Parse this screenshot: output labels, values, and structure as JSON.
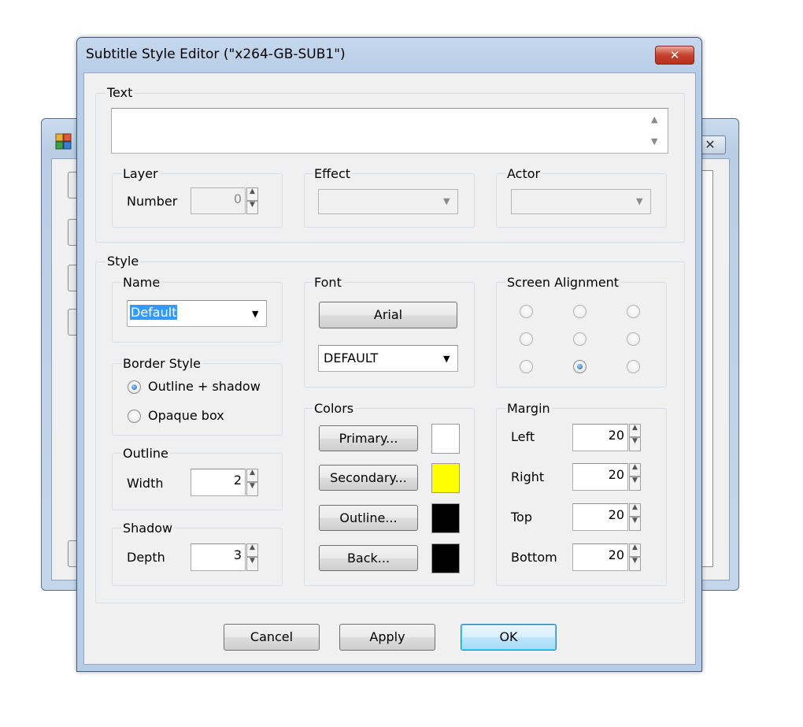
{
  "dialog": {
    "title": "Subtitle Style Editor (\"x264-GB-SUB1\")",
    "close_glyph": "✕"
  },
  "text_group": {
    "label": "Text",
    "value": ""
  },
  "layer": {
    "label": "Layer",
    "number_label": "Number",
    "number_value": "0"
  },
  "effect": {
    "label": "Effect",
    "value": ""
  },
  "actor": {
    "label": "Actor",
    "value": ""
  },
  "style": {
    "label": "Style",
    "name_label": "Name",
    "name_value": "Default",
    "border_style": {
      "label": "Border Style",
      "options": [
        "Outline + shadow",
        "Opaque box"
      ],
      "selected": "Outline + shadow"
    },
    "outline": {
      "label": "Outline",
      "width_label": "Width",
      "width_value": "2"
    },
    "shadow": {
      "label": "Shadow",
      "depth_label": "Depth",
      "depth_value": "3"
    },
    "font": {
      "label": "Font",
      "button_label": "Arial",
      "encoding_value": "DEFAULT"
    },
    "colors": {
      "label": "Colors",
      "primary_label": "Primary...",
      "secondary_label": "Secondary...",
      "outline_label": "Outline...",
      "back_label": "Back...",
      "primary_color": "#ffffff",
      "secondary_color": "#ffff00",
      "outline_color": "#000000",
      "back_color": "#000000"
    },
    "alignment": {
      "label": "Screen Alignment",
      "selected": "bottom-center"
    },
    "margin": {
      "label": "Margin",
      "left_label": "Left",
      "left_value": "20",
      "right_label": "Right",
      "right_value": "20",
      "top_label": "Top",
      "top_value": "20",
      "bottom_label": "Bottom",
      "bottom_value": "20"
    }
  },
  "buttons": {
    "cancel": "Cancel",
    "apply": "Apply",
    "ok": "OK"
  },
  "background_window": {
    "close_glyph": "✕"
  }
}
